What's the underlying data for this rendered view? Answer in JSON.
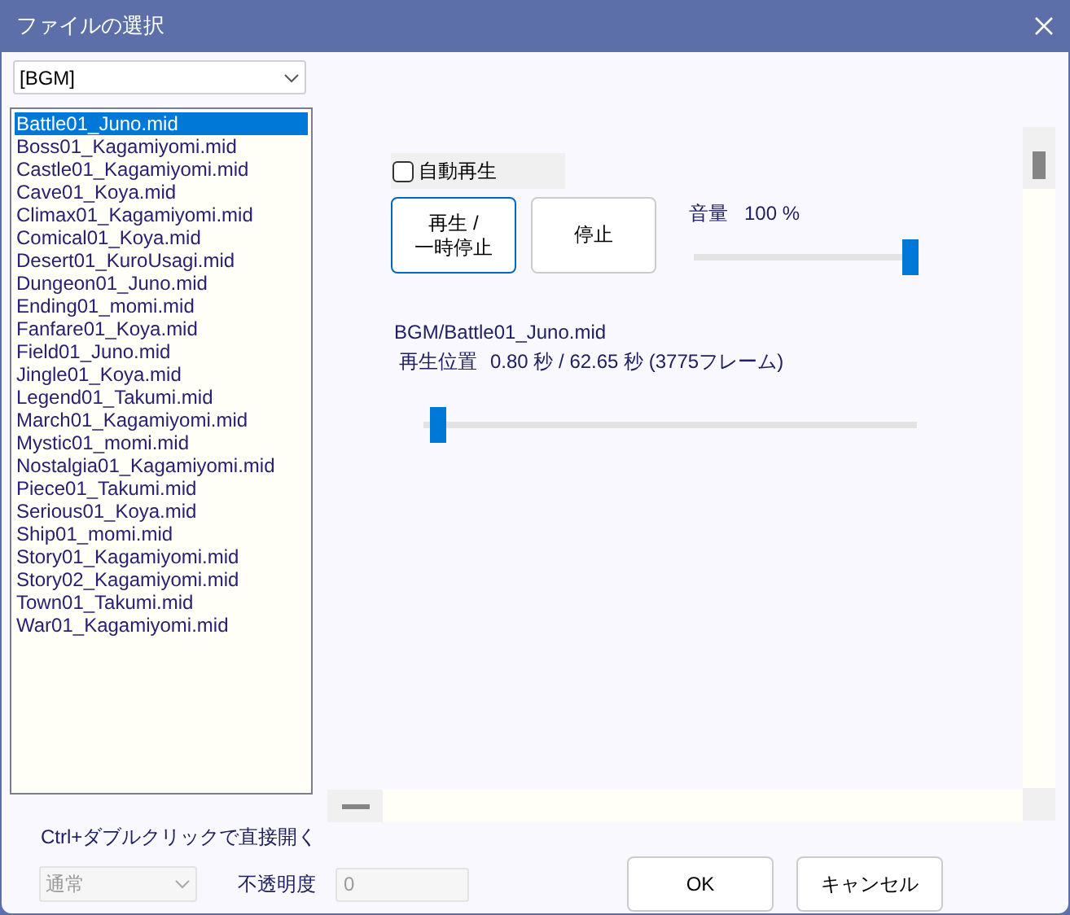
{
  "window": {
    "title": "ファイルの選択"
  },
  "folder_dropdown": {
    "value": "[BGM]"
  },
  "files": [
    {
      "label": "Battle01_Juno.mid",
      "selected": true
    },
    {
      "label": "Boss01_Kagamiyomi.mid",
      "selected": false
    },
    {
      "label": "Castle01_Kagamiyomi.mid",
      "selected": false
    },
    {
      "label": "Cave01_Koya.mid",
      "selected": false
    },
    {
      "label": "Climax01_Kagamiyomi.mid",
      "selected": false
    },
    {
      "label": "Comical01_Koya.mid",
      "selected": false
    },
    {
      "label": "Desert01_KuroUsagi.mid",
      "selected": false
    },
    {
      "label": "Dungeon01_Juno.mid",
      "selected": false
    },
    {
      "label": "Ending01_momi.mid",
      "selected": false
    },
    {
      "label": "Fanfare01_Koya.mid",
      "selected": false
    },
    {
      "label": "Field01_Juno.mid",
      "selected": false
    },
    {
      "label": "Jingle01_Koya.mid",
      "selected": false
    },
    {
      "label": "Legend01_Takumi.mid",
      "selected": false
    },
    {
      "label": "March01_Kagamiyomi.mid",
      "selected": false
    },
    {
      "label": "Mystic01_momi.mid",
      "selected": false
    },
    {
      "label": "Nostalgia01_Kagamiyomi.mid",
      "selected": false
    },
    {
      "label": "Piece01_Takumi.mid",
      "selected": false
    },
    {
      "label": "Serious01_Koya.mid",
      "selected": false
    },
    {
      "label": "Ship01_momi.mid",
      "selected": false
    },
    {
      "label": "Story01_Kagamiyomi.mid",
      "selected": false
    },
    {
      "label": "Story02_Kagamiyomi.mid",
      "selected": false
    },
    {
      "label": "Town01_Takumi.mid",
      "selected": false
    },
    {
      "label": "War01_Kagamiyomi.mid",
      "selected": false
    }
  ],
  "preview": {
    "autoplay": {
      "label": "自動再生",
      "checked": false
    },
    "buttons": [
      {
        "label": "再生 /\n一時停止",
        "focused": true
      },
      {
        "label": "停止",
        "focused": false
      }
    ],
    "volume": {
      "label": "音量",
      "reading": "100 %",
      "level": 1.0
    },
    "file_path": "BGM/Battle01_Juno.mid",
    "position": {
      "label": "再生位置",
      "reading": "0.80 秒 / 62.65 秒 (3775フレーム)",
      "level": 0.0
    }
  },
  "hint": "Ctrl+ダブルクリックで直接開く",
  "blend_dropdown": {
    "value": "通常",
    "disabled": true
  },
  "opacity": {
    "label": "不透明度",
    "value": "0",
    "disabled": true
  },
  "dialog_buttons": [
    "OK",
    "キャンセル"
  ]
}
